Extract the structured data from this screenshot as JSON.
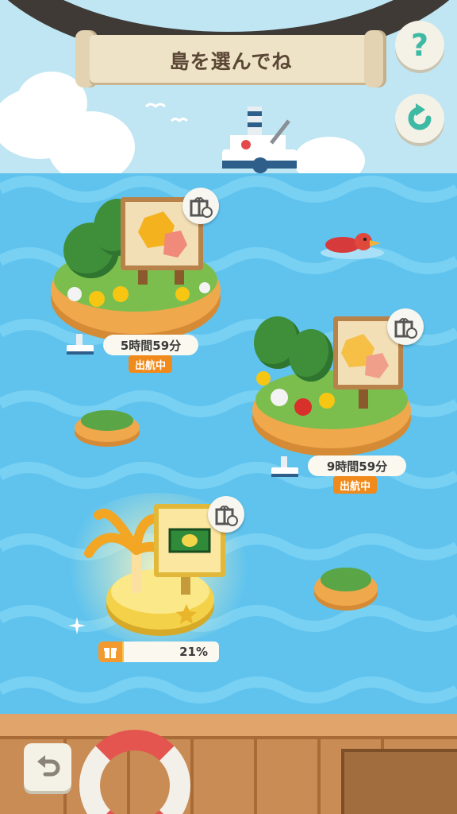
{
  "header": {
    "title": "島を選んでね"
  },
  "buttons": {
    "help_label": "?",
    "help_icon": "question-icon",
    "refresh_icon": "refresh-icon",
    "back_icon": "back-arrow-icon"
  },
  "islands": [
    {
      "id": "island-1",
      "timer": "5時間59分",
      "status": "出航中",
      "reward_icon": "gift-zoom-icon"
    },
    {
      "id": "island-2",
      "timer": "9時間59分",
      "status": "出航中",
      "reward_icon": "gift-zoom-icon"
    },
    {
      "id": "island-3",
      "progress_label": "21%",
      "progress": 0.21,
      "reward_icon": "gift-zoom-icon"
    }
  ],
  "colors": {
    "sea": "#5fc3ee",
    "sky": "#bfe6f2",
    "accent": "#3db9a4",
    "status_tag": "#f08a1a"
  }
}
